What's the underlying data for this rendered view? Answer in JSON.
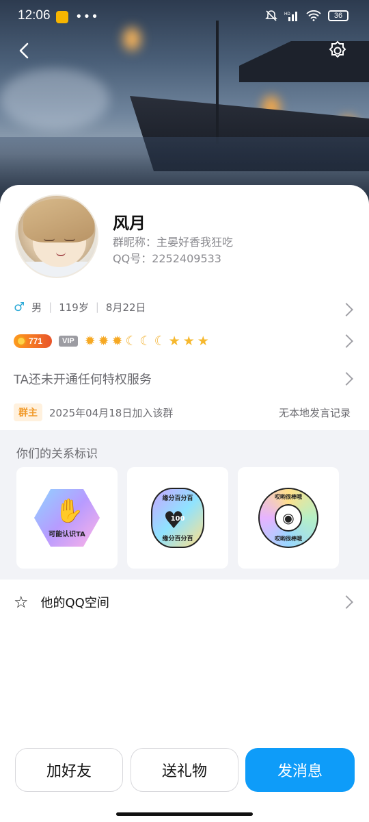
{
  "status_bar": {
    "time": "12:06",
    "battery": "36",
    "icons": [
      "weibo-icon",
      "more-dots",
      "mute-icon",
      "hd-signal-icon",
      "wifi-icon",
      "battery-icon"
    ]
  },
  "profile": {
    "name": "风月",
    "group_nickname": "群昵称：主晏好香我狂吃",
    "qq_number": "QQ号：2252409533",
    "gender_symbol": "♂",
    "gender": "男",
    "age": "119岁",
    "birthday": "8月22日",
    "level_value": "771",
    "vip_label": "VIP",
    "level_icons": [
      "sun",
      "sun",
      "sun",
      "moon",
      "moon",
      "moon",
      "star",
      "star",
      "star"
    ],
    "privilege_text": "TA还未开通任何特权服务",
    "role_badge": "群主",
    "join_text": "2025年04月18日加入该群",
    "speech_record": "无本地发言记录"
  },
  "relationship": {
    "title": "你们的关系标识",
    "stickers": [
      {
        "label": "可能认识TA"
      },
      {
        "label_top": "缘分百分百",
        "label_bottom": "缘分百分百",
        "center": "100"
      },
      {
        "label_top": "哎哟很棒哦",
        "label_bottom": "哎哟很棒哦"
      }
    ]
  },
  "qzone": {
    "label": "他的QQ空间"
  },
  "actions": {
    "add_friend": "加好友",
    "send_gift": "送礼物",
    "send_message": "发消息"
  },
  "colors": {
    "primary": "#0e9cf9",
    "gender": "#29a8d6",
    "owner_badge": "#f19a2a"
  }
}
